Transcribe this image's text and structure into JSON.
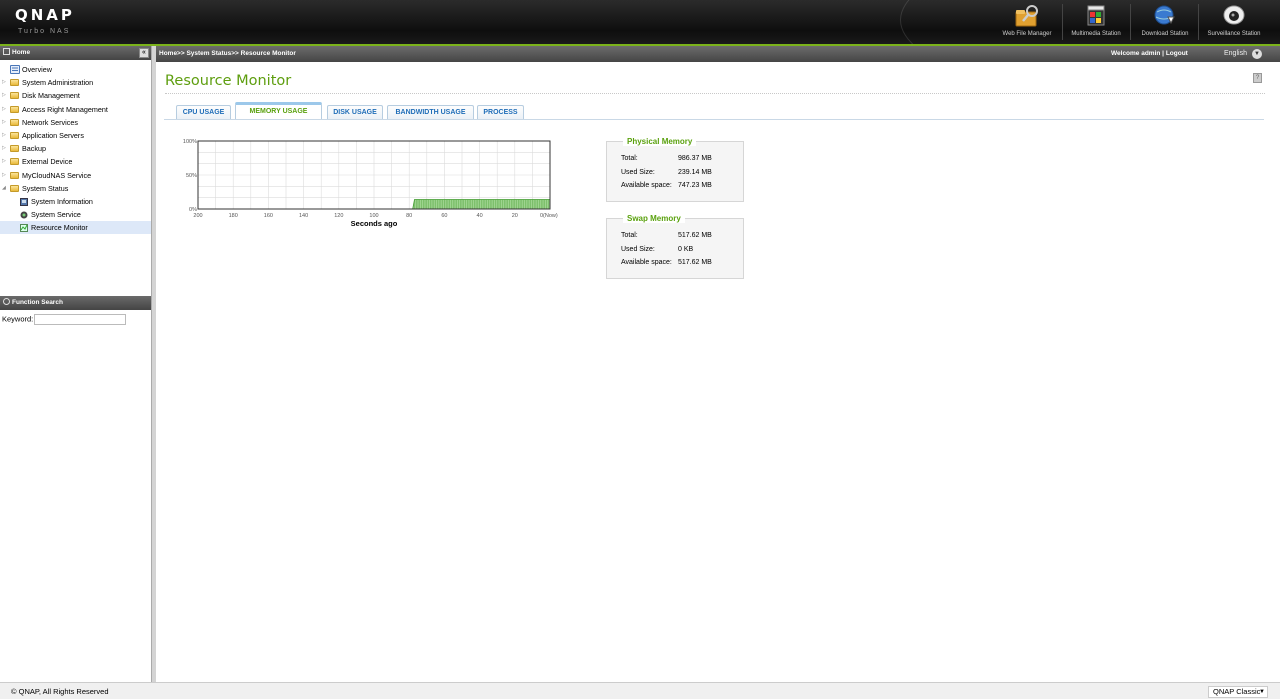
{
  "header": {
    "logo": "QNAP",
    "logo_sub": "Turbo NAS",
    "apps": [
      {
        "label": "Web File Manager",
        "icon": "web-file-manager-icon"
      },
      {
        "label": "Multimedia Station",
        "icon": "multimedia-station-icon"
      },
      {
        "label": "Download Station",
        "icon": "download-station-icon"
      },
      {
        "label": "Surveillance Station",
        "icon": "surveillance-station-icon"
      }
    ]
  },
  "sidebar": {
    "title": "Home",
    "items": [
      {
        "label": "Overview"
      },
      {
        "label": "System Administration"
      },
      {
        "label": "Disk Management"
      },
      {
        "label": "Access Right Management"
      },
      {
        "label": "Network Services"
      },
      {
        "label": "Application Servers"
      },
      {
        "label": "Backup"
      },
      {
        "label": "External Device"
      },
      {
        "label": "MyCloudNAS Service"
      },
      {
        "label": "System Status"
      },
      {
        "label": "System Information"
      },
      {
        "label": "System Service"
      },
      {
        "label": "Resource Monitor"
      }
    ],
    "function_search": {
      "title": "Function Search",
      "keyword_label": "Keyword:",
      "keyword_value": ""
    }
  },
  "topbar": {
    "breadcrumb": "Home>> System Status>> Resource Monitor",
    "welcome": "Welcome admin",
    "logout": "Logout",
    "language": "English"
  },
  "main": {
    "title": "Resource Monitor",
    "tabs": [
      {
        "label": "CPU USAGE"
      },
      {
        "label": "MEMORY USAGE",
        "active": true
      },
      {
        "label": "DISK USAGE"
      },
      {
        "label": "BANDWIDTH USAGE"
      },
      {
        "label": "PROCESS"
      }
    ],
    "physical_memory": {
      "title": "Physical Memory",
      "rows": [
        {
          "key": "Total:",
          "value": "986.37 MB"
        },
        {
          "key": "Used Size:",
          "value": "239.14 MB"
        },
        {
          "key": "Available space:",
          "value": "747.23 MB"
        }
      ]
    },
    "swap_memory": {
      "title": "Swap Memory",
      "rows": [
        {
          "key": "Total:",
          "value": "517.62 MB"
        },
        {
          "key": "Used Size:",
          "value": "0 KB"
        },
        {
          "key": "Available space:",
          "value": "517.62 MB"
        }
      ]
    }
  },
  "chart_data": {
    "type": "area",
    "xlabel": "Seconds ago",
    "ylabel": "",
    "x_ticks": [
      "200",
      "180",
      "160",
      "140",
      "120",
      "100",
      "80",
      "60",
      "40",
      "20",
      "0(Now)"
    ],
    "y_ticks": [
      "100%",
      "50%",
      "0%"
    ],
    "xlim": [
      200,
      0
    ],
    "ylim": [
      0,
      100
    ],
    "grid": true,
    "color": "#7ec66a",
    "series": [
      {
        "x": [
          78,
          77,
          0
        ],
        "y": [
          0,
          14,
          14
        ]
      }
    ]
  },
  "footer": {
    "copyright": "© QNAP, All Rights Reserved",
    "theme": "QNAP Classic"
  },
  "colors": {
    "accent_green": "#5e9e0f",
    "tab_blue": "#1f6db8",
    "header_dark": "#111111"
  }
}
